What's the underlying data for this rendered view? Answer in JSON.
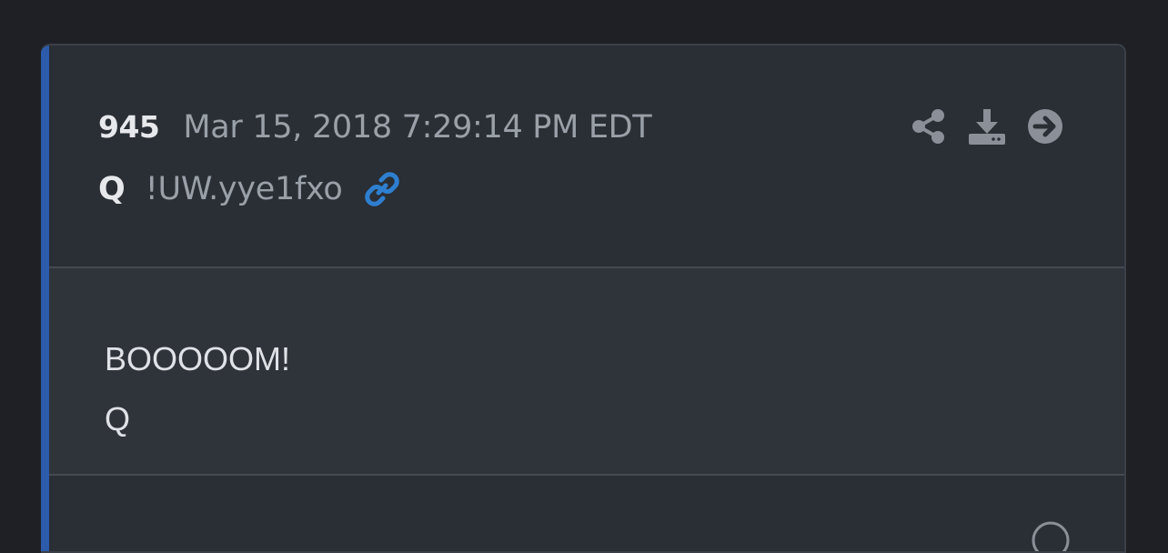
{
  "post": {
    "number": "945",
    "timestamp": "Mar 15, 2018 7:29:14 PM EDT",
    "author": "Q",
    "tripcode": "!UW.yye1fxo",
    "body_lines": [
      "BOOOOOM!",
      "Q"
    ]
  },
  "icons": {
    "link": "link-icon",
    "share": "share-icon",
    "download": "download-icon",
    "goto": "arrow-right-circle-icon"
  },
  "colors": {
    "accent": "#2c5bab",
    "link_icon": "#2f7fd0",
    "muted_icon": "#8b9098"
  }
}
